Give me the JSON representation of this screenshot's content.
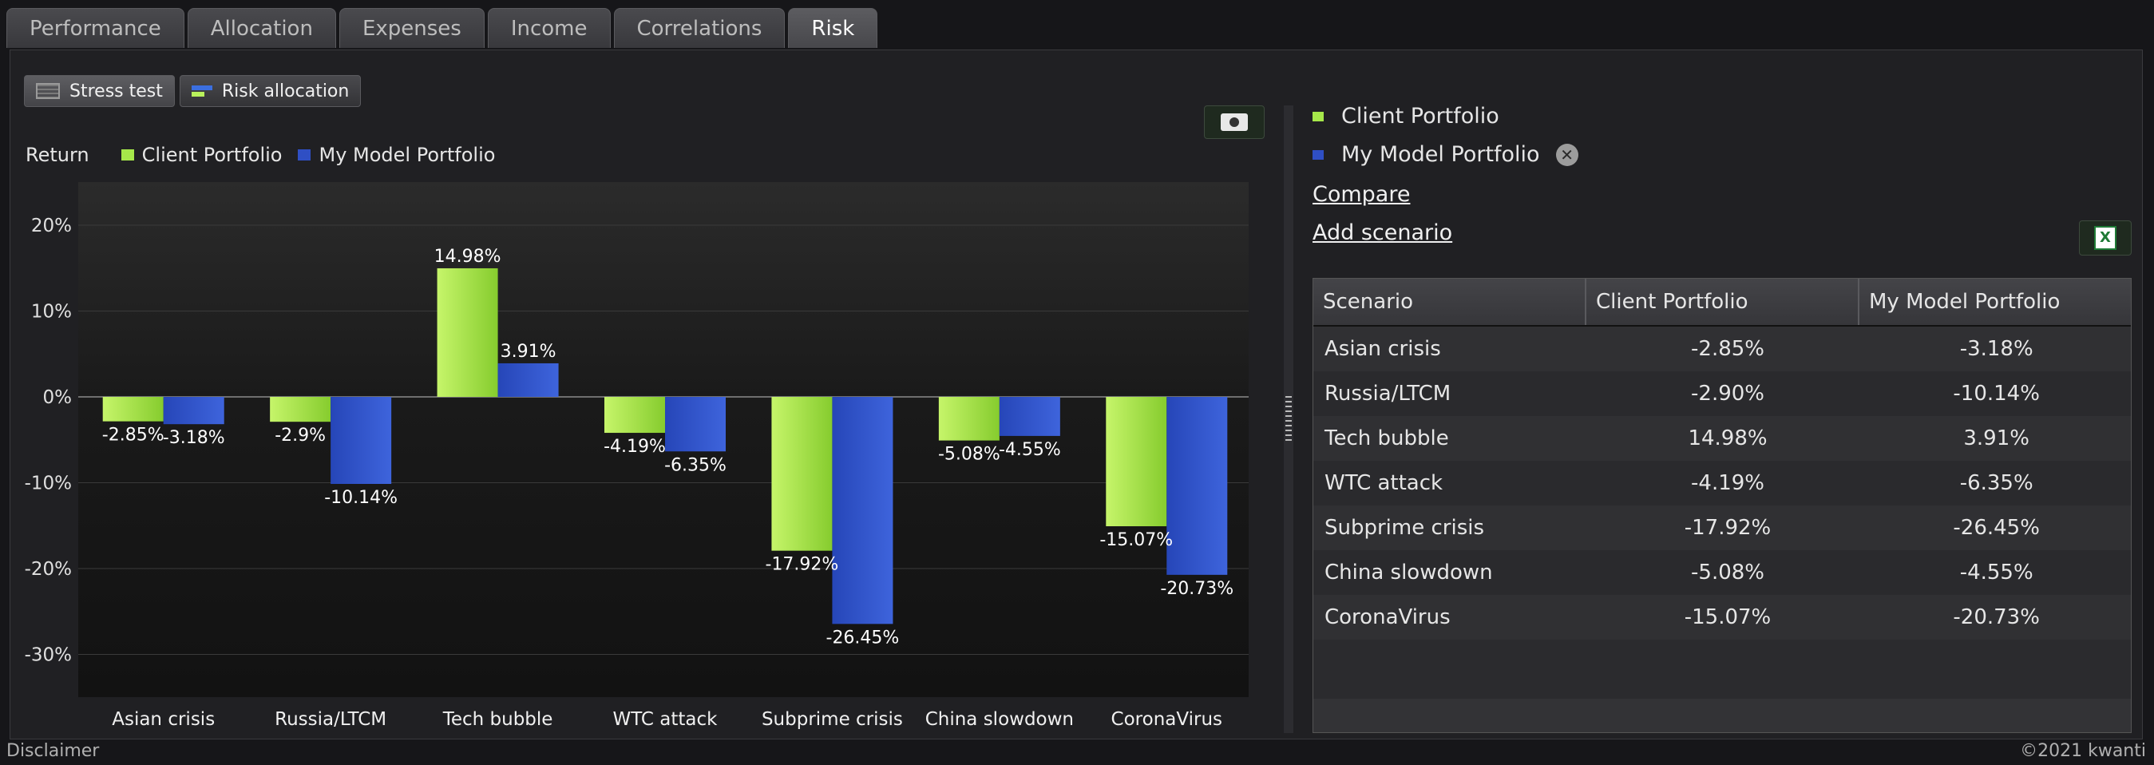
{
  "tabs": [
    "Performance",
    "Allocation",
    "Expenses",
    "Income",
    "Correlations",
    "Risk"
  ],
  "active_tab": "Risk",
  "subtabs": {
    "stress_test": "Stress test",
    "risk_allocation": "Risk allocation"
  },
  "legend": {
    "return_label": "Return",
    "client": "Client Portfolio",
    "model": "My Model Portfolio"
  },
  "colors": {
    "client": "#a6e84a",
    "model": "#2f4fc4"
  },
  "chart_data": {
    "type": "bar",
    "categories": [
      "Asian crisis",
      "Russia/LTCM",
      "Tech bubble",
      "WTC attack",
      "Subprime crisis",
      "China slowdown",
      "CoronaVirus"
    ],
    "series": [
      {
        "name": "Client Portfolio",
        "values": [
          -2.85,
          -2.9,
          14.98,
          -4.19,
          -17.92,
          -5.08,
          -15.07
        ],
        "labels": [
          "-2.85%",
          "-2.9%",
          "14.98%",
          "-4.19%",
          "-17.92%",
          "-5.08%",
          "-15.07%"
        ]
      },
      {
        "name": "My Model Portfolio",
        "values": [
          -3.18,
          -10.14,
          3.91,
          -6.35,
          -26.45,
          -4.55,
          -20.73
        ],
        "labels": [
          "-3.18%",
          "-10.14%",
          "3.91%",
          "-6.35%",
          "-26.45%",
          "-4.55%",
          "-20.73%"
        ]
      }
    ],
    "yticks": [
      20,
      10,
      0,
      -10,
      -20,
      -30
    ],
    "ytick_labels": [
      "20%",
      "10%",
      "0%",
      "-10%",
      "-20%",
      "-30%"
    ],
    "ylim": [
      -35,
      25
    ],
    "ylabel": "Return",
    "grid": true
  },
  "right_panel": {
    "legend_client": "Client Portfolio",
    "legend_model": "My Model Portfolio",
    "compare": "Compare",
    "add_scenario": "Add scenario"
  },
  "table": {
    "headers": [
      "Scenario",
      "Client Portfolio",
      "My Model Portfolio"
    ],
    "rows": [
      [
        "Asian crisis",
        "-2.85%",
        "-3.18%"
      ],
      [
        "Russia/LTCM",
        "-2.90%",
        "-10.14%"
      ],
      [
        "Tech bubble",
        "14.98%",
        "3.91%"
      ],
      [
        "WTC attack",
        "-4.19%",
        "-6.35%"
      ],
      [
        "Subprime crisis",
        "-17.92%",
        "-26.45%"
      ],
      [
        "China slowdown",
        "-5.08%",
        "-4.55%"
      ],
      [
        "CoronaVirus",
        "-15.07%",
        "-20.73%"
      ]
    ]
  },
  "footer": {
    "disclaimer": "Disclaimer",
    "copyright": "©2021 kwanti"
  }
}
